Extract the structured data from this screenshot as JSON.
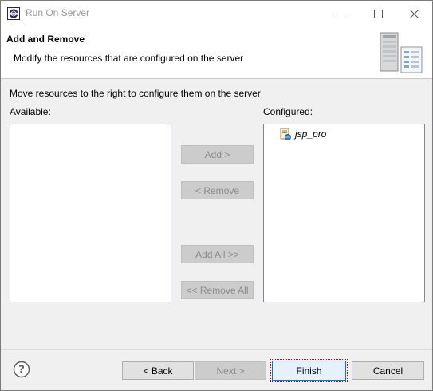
{
  "window": {
    "title": "Run On Server"
  },
  "header": {
    "title": "Add and Remove",
    "description": "Modify the resources that are configured on the server"
  },
  "body": {
    "intro": "Move resources to the right to configure them on the server",
    "available_label": "Available:",
    "configured_label": "Configured:",
    "available_items": [],
    "configured_items": [
      {
        "label": "jsp_pro",
        "icon": "web-project-icon"
      }
    ]
  },
  "transfer_buttons": {
    "add": "Add >",
    "remove": "< Remove",
    "add_all": "Add All >>",
    "remove_all": "<< Remove All"
  },
  "footer": {
    "back": "< Back",
    "next": "Next >",
    "finish": "Finish",
    "cancel": "Cancel"
  },
  "state": {
    "add_enabled": false,
    "remove_enabled": false,
    "add_all_enabled": false,
    "remove_all_enabled": false,
    "next_enabled": false,
    "focused_button": "finish"
  }
}
